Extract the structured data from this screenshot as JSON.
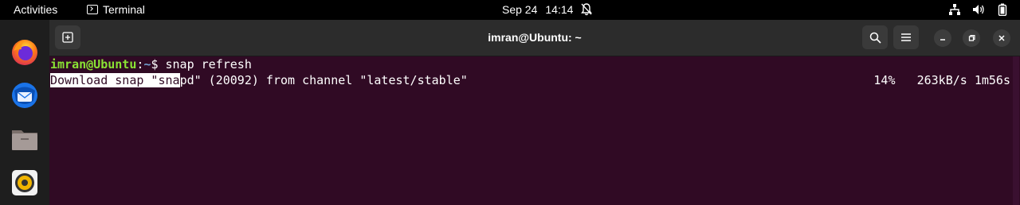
{
  "topbar": {
    "activities": "Activities",
    "app_name": "Terminal",
    "date": "Sep 24",
    "time": "14:14"
  },
  "dock": {
    "items": [
      "firefox-icon",
      "thunderbird-icon",
      "files-icon",
      "rhythmbox-icon"
    ]
  },
  "window": {
    "title": "imran@Ubuntu: ~"
  },
  "terminal": {
    "prompt_user": "imran@Ubuntu",
    "prompt_sep": ":",
    "prompt_path": "~",
    "prompt_symbol": "$ ",
    "command": "snap refresh",
    "output_selected": "Download snap \"sna",
    "output_rest": "pd\" (20092) from channel \"latest/stable\"",
    "progress_percent": "14%",
    "speed": "263kB/s",
    "eta": "1m56s"
  },
  "colors": {
    "terminal_bg": "#300a24",
    "prompt_user": "#8ae234",
    "prompt_path": "#729fcf",
    "headerbar": "#2c2c2c"
  }
}
